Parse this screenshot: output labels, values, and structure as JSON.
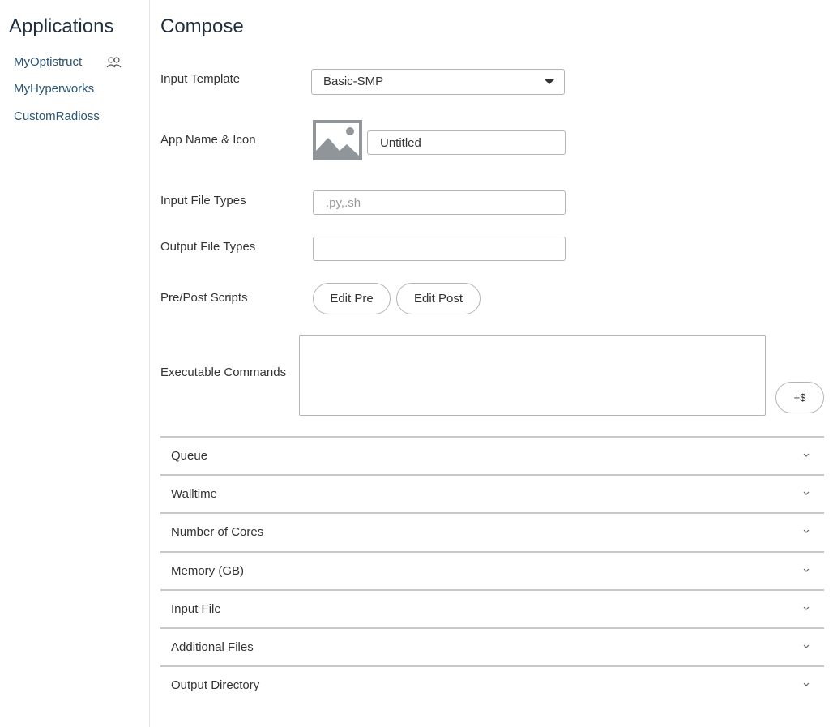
{
  "sidebar": {
    "title": "Applications",
    "items": [
      {
        "label": "MyOptistruct",
        "icon": "shared-users-icon"
      },
      {
        "label": "MyHyperworks"
      },
      {
        "label": "CustomRadioss"
      }
    ]
  },
  "compose": {
    "title": "Compose",
    "input_template": {
      "label": "Input Template",
      "value": "Basic-SMP"
    },
    "app_name": {
      "label": "App Name & Icon",
      "value": "Untitled",
      "icon": "image-placeholder-icon"
    },
    "input_file_types": {
      "label": "Input File Types",
      "value": "",
      "placeholder": ".py,.sh"
    },
    "output_file_types": {
      "label": "Output File Types",
      "value": "",
      "placeholder": ""
    },
    "scripts": {
      "label": "Pre/Post Scripts",
      "edit_pre": "Edit Pre",
      "edit_post": "Edit Post"
    },
    "commands": {
      "label": "Executable Commands",
      "value": "",
      "add_var_button": "+$"
    }
  },
  "sections": [
    {
      "label": "Queue"
    },
    {
      "label": "Walltime"
    },
    {
      "label": "Number of Cores"
    },
    {
      "label": "Memory (GB)"
    },
    {
      "label": "Input File"
    },
    {
      "label": "Additional Files"
    },
    {
      "label": "Output Directory"
    }
  ]
}
